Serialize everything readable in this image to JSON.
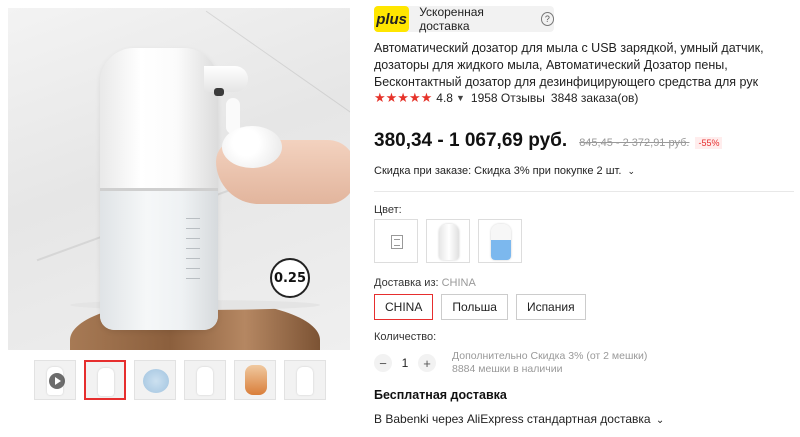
{
  "gallery": {
    "badge_text": "0.25",
    "thumbnails": [
      "video-thumb",
      "dispenser-hand",
      "dispenser-foam",
      "dispenser-blue",
      "child-washing",
      "dispenser-counter"
    ]
  },
  "delivery_pill": {
    "badge": "plus",
    "text": "Ускоренная доставка",
    "help": "?"
  },
  "product": {
    "title": "Автоматический дозатор для мыла с USB зарядкой, умный датчик, дозаторы для жидкого мыла, Автоматический Дозатор пены, Бесконтактный дозатор для дезинфицирующего средства для рук",
    "rating": "4.8",
    "stars": "★★★★★",
    "reviews": "1958 Отзывы",
    "orders": "3848 заказа(ов)",
    "price": "380,34 - 1 067,69 руб.",
    "old_price": "845,45 - 2 372,91 руб.",
    "discount": "-55%",
    "coupon": "Скидка при заказе: Скидка 3% при покупке 2 шт."
  },
  "color": {
    "label": "Цвет:",
    "options": [
      "no-image",
      "white",
      "blue"
    ]
  },
  "shipping_from": {
    "label": "Доставка из:",
    "value": "CHINA",
    "options": [
      "CHINA",
      "Польша",
      "Испания"
    ]
  },
  "quantity": {
    "label": "Количество:",
    "value": "1",
    "minus": "−",
    "plus": "+",
    "note_line1": "Дополнительно Скидка 3% (от 2 мешки)",
    "note_line2": "8884 мешки в наличии"
  },
  "shipping": {
    "free": "Бесплатная доставка",
    "method": "В Babenki через AliExpress стандартная доставка"
  },
  "colors": {
    "accent": "#e62e2e",
    "plus_yellow": "#ffe600",
    "star": "#e6332a"
  }
}
